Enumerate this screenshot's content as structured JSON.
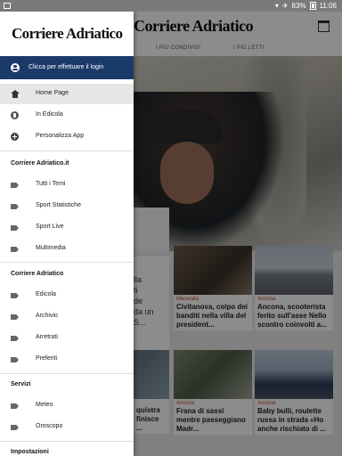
{
  "status": {
    "battery": "83%",
    "time": "11:06"
  },
  "app": {
    "logo": "Corriere Adriatico",
    "tabs": [
      "I PIÙ CONDIVISI",
      "I PIÙ LETTI"
    ],
    "feature_text": "lla\nti\nde\nda un\nS...",
    "cards": [
      {
        "category": "Macerata",
        "title": "Civitanova, colpo dei banditi nella villa del president..."
      },
      {
        "category": "Ancona",
        "title": "Ancona, scooterista ferito sull'asse Nello scontro coinvolti a..."
      },
      {
        "category": "",
        "title": "quistra\nfinisce ..."
      },
      {
        "category": "Ancona",
        "title": "Frana di sassi mentre passeggiano Madr..."
      },
      {
        "category": "Ancona",
        "title": "Baby bulli, roulette russa in strada «Ho anche rischiato di ..."
      }
    ]
  },
  "drawer": {
    "logo": "Corriere Adriatico",
    "login_label": "Clicca per effettuare il login",
    "main_items": [
      {
        "label": "Home Page",
        "icon": "home-icon"
      },
      {
        "label": "In Edicola",
        "icon": "edicola-icon"
      },
      {
        "label": "Personalizza App",
        "icon": "add-circle-icon"
      }
    ],
    "sections": [
      {
        "title": "Corriere Adriatico.it",
        "items": [
          "Tutti i Temi",
          "Sport Statistiche",
          "Sport Live",
          "Multimedia"
        ]
      },
      {
        "title": "Corriere Adriatico",
        "items": [
          "Edicola",
          "Archivio",
          "Arretrati",
          "Preferiti"
        ]
      },
      {
        "title": "Servizi",
        "items": [
          "Meteo",
          "Oroscopo"
        ]
      },
      {
        "title": "Impostazioni",
        "items": []
      }
    ]
  }
}
